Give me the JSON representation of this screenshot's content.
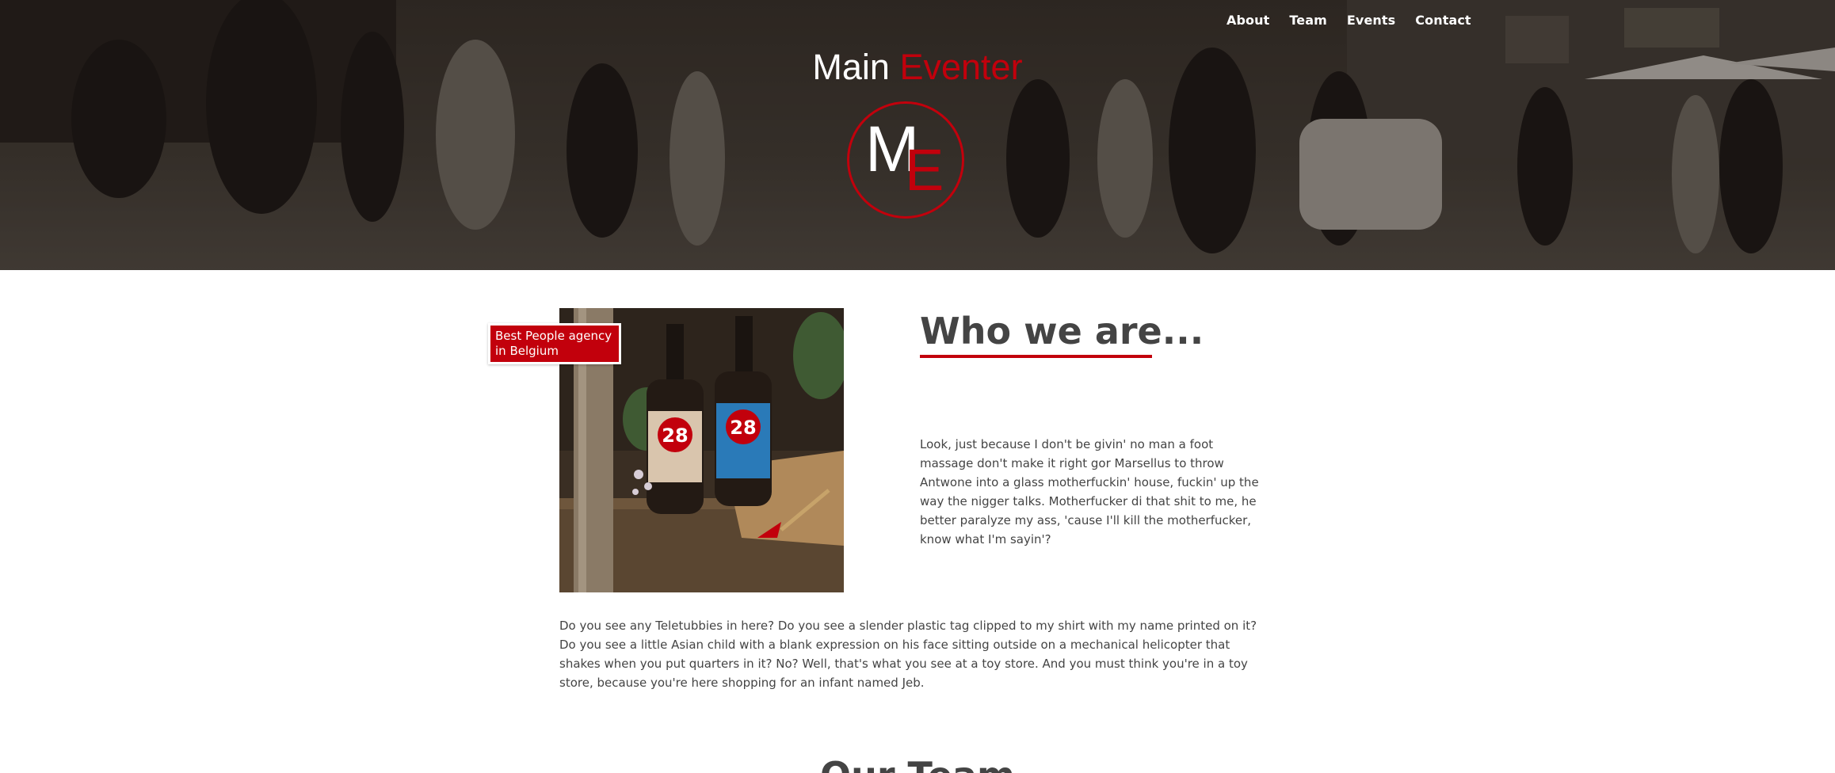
{
  "nav": {
    "items": [
      {
        "label": "About"
      },
      {
        "label": "Team"
      },
      {
        "label": "Events"
      },
      {
        "label": "Contact"
      }
    ]
  },
  "brand": {
    "title_main": "Main",
    "title_accent": "Eventer",
    "logo_letter_m": "M",
    "logo_letter_e": "E"
  },
  "about": {
    "badge": "Best People agency in Belgium",
    "heading": "Who we are...",
    "paragraph": "Look, just because I don't be givin' no man a foot massage don't make it right gor Marsellus to throw Antwone into a glass motherfuckin' house, fuckin' up the way the nigger talks. Motherfucker di that shit to me, he better paralyze my ass, 'cause I'll kill the motherfucker, know what I'm sayin'?",
    "wide_paragraph": "Do you see any Teletubbies in here? Do you see a slender plastic tag clipped to my shirt with my name printed on it? Do you see a little Asian child with a blank expression on his face sitting outside on a mechanical helicopter that shakes when you put quarters in it? No? Well, that's what you see at a toy store. And you must think you're in a toy store, because you're here shopping for an infant named Jeb.",
    "bottle_left_label": "28",
    "bottle_right_label": "28"
  },
  "team": {
    "heading": "Our Team"
  },
  "colors": {
    "accent": "#c2000c",
    "text": "#444444",
    "white": "#ffffff"
  }
}
